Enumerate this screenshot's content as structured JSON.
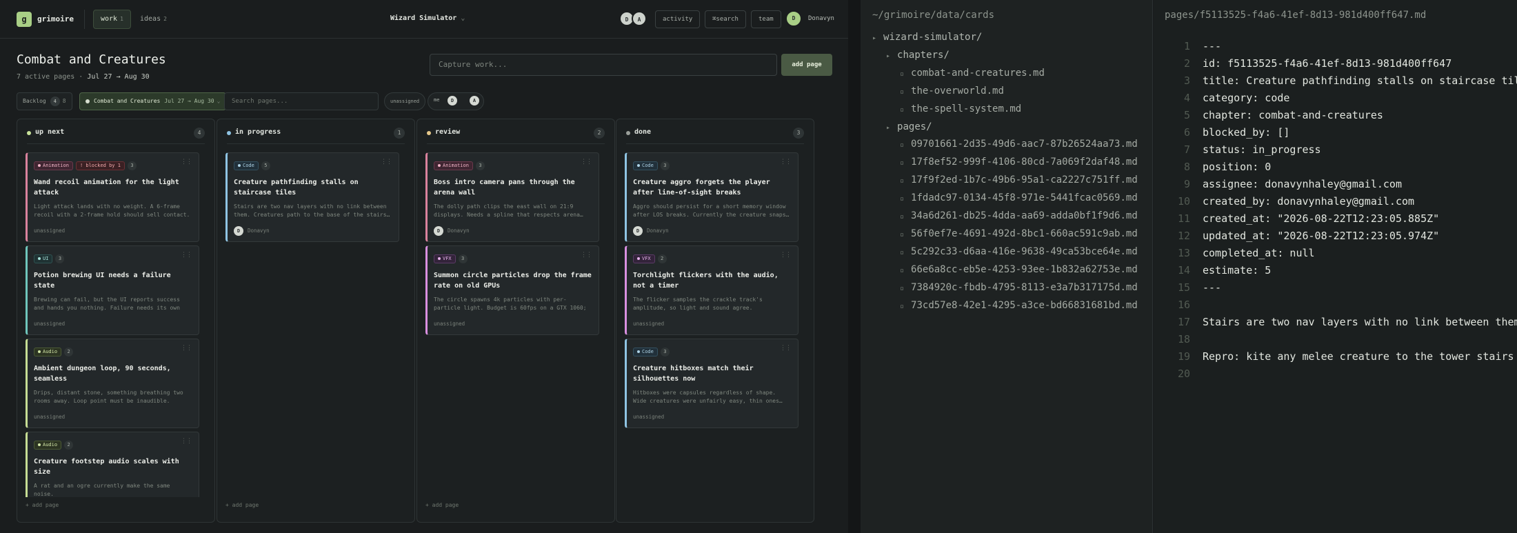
{
  "app": {
    "logo_letter": "g",
    "name": "grimoire",
    "nav": [
      {
        "label": "work",
        "count": "1"
      },
      {
        "label": "ideas",
        "count": "2"
      }
    ],
    "project": "Wizard Simulator",
    "project_chevron": "⌄",
    "header_avatars": [
      "D",
      "A"
    ],
    "buttons": {
      "activity": "activity",
      "search": "⌘search",
      "team": "team"
    },
    "user": {
      "initial": "D",
      "name": "Donavyn"
    }
  },
  "page": {
    "title": "Combat and Creatures",
    "subtitle_prefix": "7 active pages · ",
    "subtitle_range": "Jul 27 → Aug 30",
    "capture_placeholder": "Capture work...",
    "add_button": "add page"
  },
  "filters": {
    "backlog": {
      "label": "Backlog",
      "count": "4",
      "extra": "8"
    },
    "active": {
      "label": "Combat and Creatures",
      "range": "Jul 27 → Aug 30",
      "extra": "⌄"
    },
    "search_placeholder": "Search pages...",
    "unassigned": "unassigned",
    "me": "me",
    "seg_avatars": [
      "D",
      "A"
    ]
  },
  "columns": [
    {
      "id": "up-next",
      "title": "up next",
      "count": "4",
      "dot": "#c9e39a",
      "add_label": "+ add page",
      "cards": [
        {
          "tags": [
            {
              "type": "anim",
              "label": "Animation"
            },
            {
              "type": "blocked",
              "label": "! blocked by 1"
            }
          ],
          "estimate": "3",
          "title": "Wand recoil animation for the light attack",
          "desc": "Light attack lands with no weight. A 6-frame recoil with a 2-frame hold should sell contact.",
          "assignee": "unassigned",
          "assignee_initial": "",
          "accent": "#d9829d"
        },
        {
          "tags": [
            {
              "type": "ui",
              "label": "UI"
            }
          ],
          "estimate": "3",
          "title": "Potion brewing UI needs a failure state",
          "desc": "Brewing can fail, but the UI reports success and hands you nothing. Failure needs its own moment …",
          "assignee": "unassigned",
          "assignee_initial": "",
          "accent": "#6fc6bc"
        },
        {
          "tags": [
            {
              "type": "audio",
              "label": "Audio"
            }
          ],
          "estimate": "2",
          "title": "Ambient dungeon loop, 90 seconds, seamless",
          "desc": "Drips, distant stone, something breathing two rooms away. Loop point must be inaudible.",
          "assignee": "unassigned",
          "assignee_initial": "",
          "accent": "#c6dd94"
        },
        {
          "tags": [
            {
              "type": "audio",
              "label": "Audio"
            }
          ],
          "estimate": "2",
          "title": "Creature footstep audio scales with size",
          "desc": "A rat and an ogre currently make the same noise.",
          "assignee": "",
          "assignee_initial": "",
          "accent": "#c6dd94"
        }
      ]
    },
    {
      "id": "in-progress",
      "title": "in progress",
      "count": "1",
      "dot": "#8fc4e3",
      "add_label": "+ add page",
      "cards": [
        {
          "tags": [
            {
              "type": "code",
              "label": "Code"
            }
          ],
          "estimate": "5",
          "title": "Creature pathfinding stalls on staircase tiles",
          "desc": "Stairs are two nav layers with no link between them. Creatures path to the base of the stairs…",
          "assignee": "Donavyn",
          "assignee_initial": "D",
          "accent": "#8fc4e3"
        }
      ]
    },
    {
      "id": "review",
      "title": "review",
      "count": "2",
      "dot": "#e6c88a",
      "add_label": "+ add page",
      "cards": [
        {
          "tags": [
            {
              "type": "anim",
              "label": "Animation"
            }
          ],
          "estimate": "3",
          "title": "Boss intro camera pans through the arena wall",
          "desc": "The dolly path clips the east wall on 21:9 displays. Needs a spline that respects arena…",
          "assignee": "Donavyn",
          "assignee_initial": "D",
          "accent": "#d9829d"
        },
        {
          "tags": [
            {
              "type": "vfx",
              "label": "VFX"
            }
          ],
          "estimate": "3",
          "title": "Summon circle particles drop the frame rate on old GPUs",
          "desc": "The circle spawns 4k particles with per-particle light. Budget is 60fps on a GTX 1060; currently…",
          "assignee": "unassigned",
          "assignee_initial": "",
          "accent": "#d98fe0"
        }
      ]
    },
    {
      "id": "done",
      "title": "done",
      "count": "3",
      "dot": "#9a9f9a",
      "add_label": "",
      "cards": [
        {
          "tags": [
            {
              "type": "code",
              "label": "Code"
            }
          ],
          "estimate": "3",
          "title": "Creature aggro forgets the player after line-of-sight breaks",
          "desc": "Aggro should persist for a short memory window after LOS breaks. Currently the creature snaps…",
          "assignee": "Donavyn",
          "assignee_initial": "D",
          "accent": "#8fc4e3"
        },
        {
          "tags": [
            {
              "type": "vfx",
              "label": "VFX"
            }
          ],
          "estimate": "2",
          "title": "Torchlight flickers with the audio, not a timer",
          "desc": "The flicker samples the crackle track's amplitude, so light and sound agree.",
          "assignee": "unassigned",
          "assignee_initial": "",
          "accent": "#d98fe0"
        },
        {
          "tags": [
            {
              "type": "code",
              "label": "Code"
            }
          ],
          "estimate": "3",
          "title": "Creature hitboxes match their silhouettes now",
          "desc": "Hitboxes were capsules regardless of shape. Wide creatures were unfairly easy, thin ones…",
          "assignee": "unassigned",
          "assignee_initial": "",
          "accent": "#8fc4e3"
        }
      ]
    }
  ],
  "tree": {
    "path": "~/grimoire/data/cards",
    "root": "wizard-simulator/",
    "chapters_dir": "chapters/",
    "chapters": [
      "combat-and-creatures.md",
      "the-overworld.md",
      "the-spell-system.md"
    ],
    "pages_dir": "pages/",
    "pages": [
      "09701661-2d35-49d6-aac7-87b26524aa73.md",
      "17f8ef52-999f-4106-80cd-7a069f2daf48.md",
      "17f9f2ed-1b7c-49b6-95a1-ca2227c751ff.md",
      "1fdadc97-0134-45f8-971e-5441fcac0569.md",
      "34a6d261-db25-4dda-aa69-adda0bf1f9d6.md",
      "56f0ef7e-4691-492d-8bc1-660ac591c9ab.md",
      "5c292c33-d6aa-416e-9638-49ca53bce64e.md",
      "66e6a8cc-eb5e-4253-93ee-1b832a62753e.md",
      "7384920c-fbdb-4795-8113-e3a7b317175d.md",
      "73cd57e8-42e1-4295-a3ce-bd66831681bd.md"
    ],
    "marker_open": "▸",
    "marker_file": "▫"
  },
  "editor": {
    "path": "pages/f5113525-f4a6-41ef-8d13-981d400ff647.md",
    "lines": [
      "---",
      "id: f5113525-f4a6-41ef-8d13-981d400ff647",
      "title: Creature pathfinding stalls on staircase tiles",
      "category: code",
      "chapter: combat-and-creatures",
      "blocked_by: []",
      "status: in_progress",
      "position: 0",
      "assignee: donavynhaley@gmail.com",
      "created_by: donavynhaley@gmail.com",
      "created_at: \"2026-08-22T12:23:05.885Z\"",
      "updated_at: \"2026-08-22T12:23:05.974Z\"",
      "completed_at: null",
      "estimate: 5",
      "---",
      "",
      "Stairs are two nav layers with no link between them. Creatures path to the base of the stairs and stall.",
      "",
      "Repro: kite any melee creature to the tower stairs in the east wing.",
      ""
    ]
  }
}
